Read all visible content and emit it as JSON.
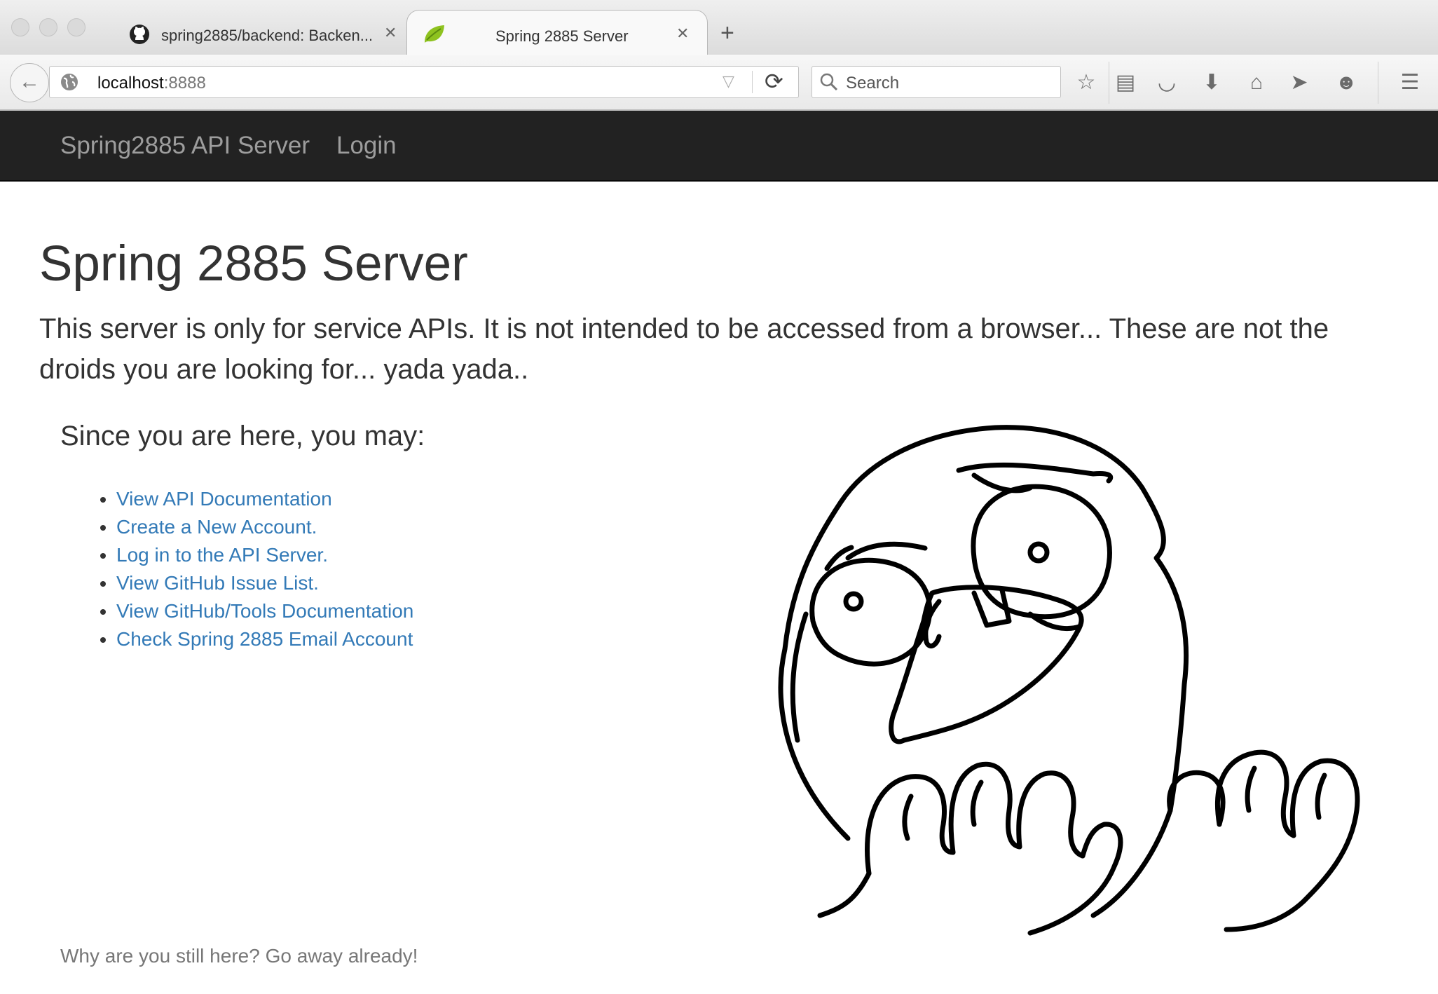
{
  "browser": {
    "tabs": [
      {
        "title": "spring2885/backend: Backen...",
        "icon": "github-icon",
        "active": false
      },
      {
        "title": "Spring 2885 Server",
        "icon": "spring-leaf-icon",
        "active": true
      }
    ],
    "url_host": "localhost",
    "url_port": ":8888",
    "search_placeholder": "Search",
    "toolbar_icons": [
      "bookmark-star-icon",
      "reading-list-icon",
      "pocket-icon",
      "download-icon",
      "home-icon",
      "send-icon",
      "chat-icon",
      "menu-icon"
    ]
  },
  "navbar": {
    "brand": "Spring2885 API Server",
    "login": "Login"
  },
  "main": {
    "title": "Spring 2885 Server",
    "lead": "This server is only for service APIs. It is not intended to be accessed from a browser... These are not the droids you are looking for... yada yada..",
    "since": "Since you are here, you may:",
    "links": [
      "View API Documentation",
      "Create a New Account.",
      "Log in to the API Server.",
      "View GitHub Issue List.",
      "View GitHub/Tools Documentation",
      "Check Spring 2885 Email Account"
    ],
    "image_name": "rage-face-illustration"
  },
  "footer": {
    "text": "Why are you still here? Go away already!"
  },
  "colors": {
    "navbar_bg": "#222222",
    "navbar_text": "#9d9d9d",
    "link": "#337ab7",
    "heading": "#333333"
  }
}
